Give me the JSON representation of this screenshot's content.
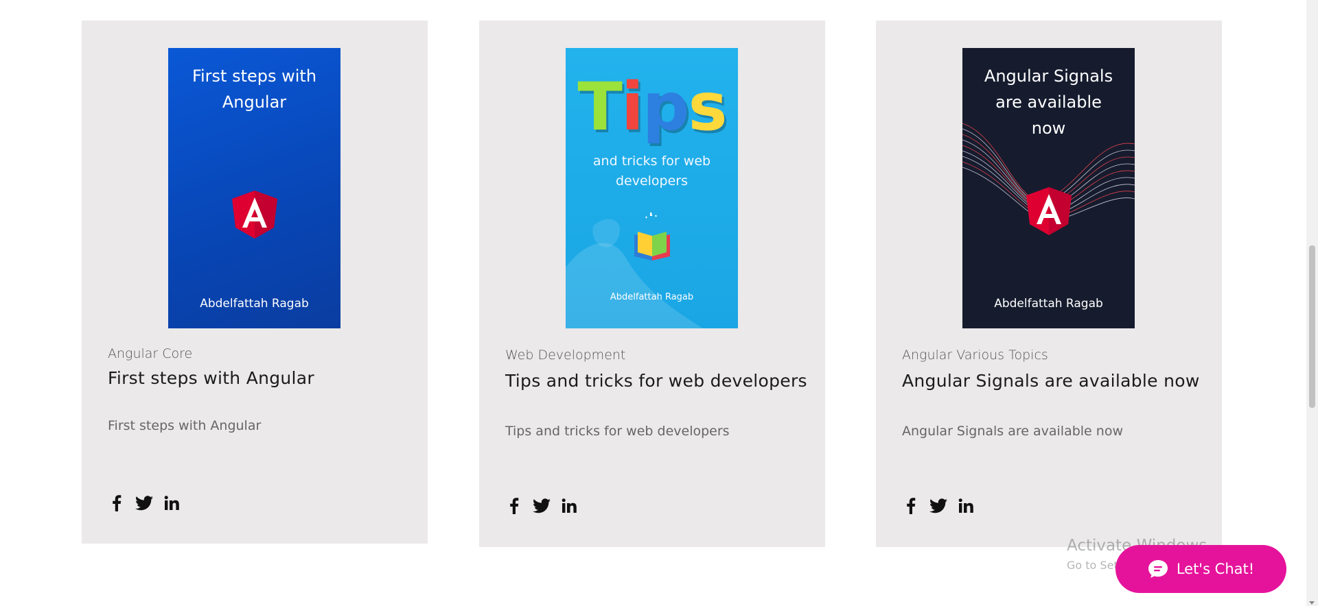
{
  "posts": [
    {
      "cover": {
        "title": "First steps with Angular",
        "author": "Abdelfattah Ragab",
        "logo": "angular-logo"
      },
      "category": "Angular Core",
      "title": "First steps with Angular",
      "excerpt": "First steps with Angular"
    },
    {
      "cover": {
        "headline": "Tips",
        "subtitle": "and tricks for web developers",
        "author": "Abdelfattah Ragab"
      },
      "category": "Web Development",
      "title": "Tips and tricks for web developers",
      "excerpt": "Tips and tricks for web developers"
    },
    {
      "cover": {
        "title": "Angular Signals are available now",
        "author": "Abdelfattah Ragab",
        "logo": "angular-logo"
      },
      "category": "Angular Various Topics",
      "title": "Angular Signals are available now",
      "excerpt": "Angular Signals are available now"
    }
  ],
  "share_icons": [
    "facebook-icon",
    "twitter-icon",
    "linkedin-icon"
  ],
  "watermark": {
    "title": "Activate Windows",
    "subtitle": "Go to Settings to activate Windows."
  },
  "chat": {
    "label": "Let's Chat!"
  },
  "colors": {
    "card_background": "#ebe9ea",
    "chat_button": "#e5139b",
    "angular_red": "#dd0031",
    "cover_1": "#0847b8",
    "cover_2": "#1aa6e4",
    "cover_3": "#161c2e"
  }
}
